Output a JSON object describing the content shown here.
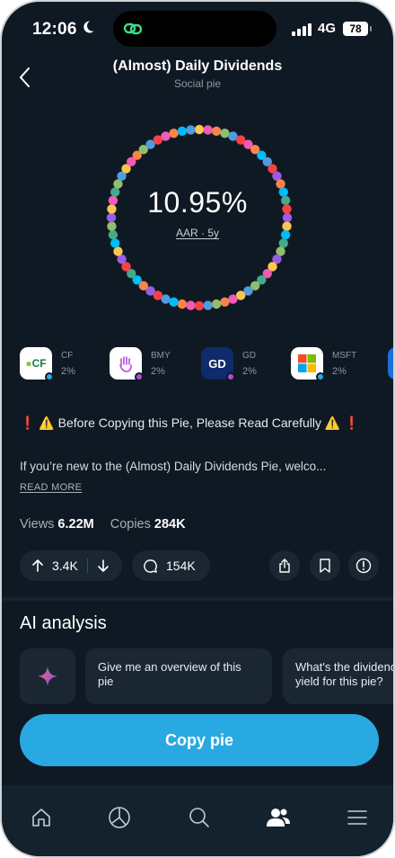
{
  "status_bar": {
    "time": "12:06",
    "network": "4G",
    "battery": "78",
    "icons": [
      "moon-icon",
      "signal-icon",
      "battery-icon"
    ]
  },
  "header": {
    "title": "(Almost) Daily Dividends",
    "subtitle": "Social pie",
    "back_icon": "chevron-left-icon"
  },
  "performance": {
    "value": "10.95%",
    "label": "AAR · 5y"
  },
  "holdings": [
    {
      "ticker": "CF",
      "weight": "2%",
      "logo_text": "CF",
      "logo_bg": "#ffffff",
      "logo_color": "#1b7a3e",
      "dot": "#29a9e1"
    },
    {
      "ticker": "BMY",
      "weight": "2%",
      "logo_text": "",
      "logo_bg": "#ffffff",
      "logo_color": "#b84ad6",
      "dot": "#b84ad6"
    },
    {
      "ticker": "GD",
      "weight": "2%",
      "logo_text": "GD",
      "logo_bg": "#0f2b6b",
      "logo_color": "#ffffff",
      "dot": "#b84ad6"
    },
    {
      "ticker": "MSFT",
      "weight": "2%",
      "logo_text": "",
      "logo_bg": "#ffffff",
      "logo_color": "#000000",
      "dot": "#29a9e1"
    }
  ],
  "description": {
    "warning": "❗ ⚠️ Before Copying this Pie, Please Read Carefully ⚠️ ❗",
    "text": "If you’re new to the (Almost) Daily Dividends Pie, welco...",
    "read_more": "READ MORE"
  },
  "stats": {
    "views_label": "Views",
    "views_value": "6.22M",
    "copies_label": "Copies",
    "copies_value": "284K"
  },
  "actions": {
    "upvotes": "3.4K",
    "comments": "154K",
    "icons": [
      "arrow-up-icon",
      "arrow-down-icon",
      "comment-icon",
      "share-icon",
      "bookmark-icon",
      "report-icon"
    ]
  },
  "ai_analysis": {
    "title": "AI analysis",
    "prompts": [
      "Give me an overview of this pie",
      "What's the dividend yield for this pie?"
    ]
  },
  "copy_button": {
    "label": "Copy pie",
    "color": "#29a9e1"
  },
  "tab_bar": {
    "tabs": [
      "home-icon",
      "portfolio-icon",
      "search-icon",
      "social-icon",
      "menu-icon"
    ],
    "active": "social-icon"
  },
  "colors": {
    "background": "#0f1923",
    "card": "#1a2733",
    "accent": "#29a9e1",
    "ring_palette": [
      "#f9c74f",
      "#f9844a",
      "#43aa8b",
      "#4d9de0",
      "#9b5de5",
      "#f15bb5",
      "#00bbf9",
      "#90be6d",
      "#f94144"
    ]
  }
}
